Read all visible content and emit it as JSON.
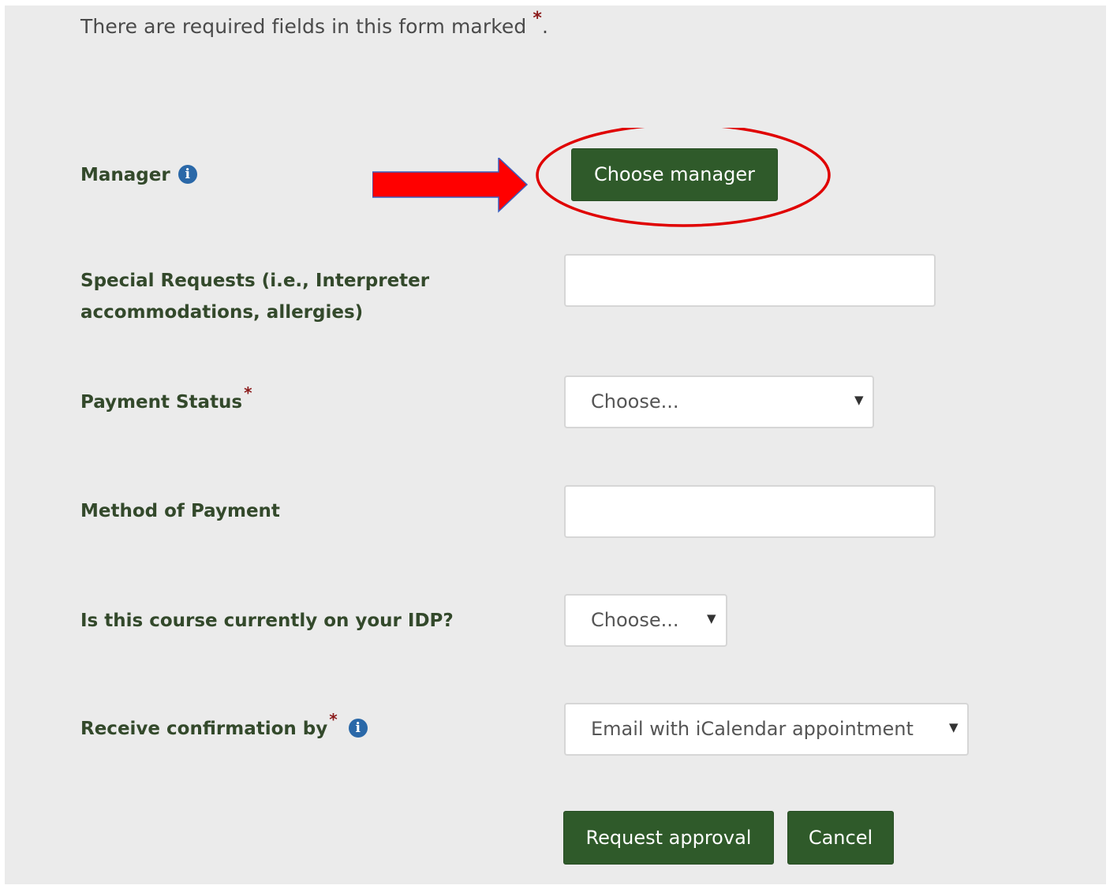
{
  "form": {
    "required_notice": "There are required fields in this form marked",
    "required_marker": "*",
    "notice_end": ".",
    "info_icon_glyph": "i"
  },
  "fields": {
    "manager": {
      "label": "Manager",
      "button_label": "Choose manager",
      "icon": "info-icon"
    },
    "special_requests": {
      "label_line1": "Special Requests (i.e., Interpreter",
      "label_line2": "accommodations, allergies)",
      "value": ""
    },
    "payment_status": {
      "label": "Payment Status",
      "required": "*",
      "selected": "Choose..."
    },
    "method_of_payment": {
      "label": "Method of Payment",
      "value": ""
    },
    "idp": {
      "label": "Is this course currently on your IDP?",
      "selected": "Choose..."
    },
    "confirmation": {
      "label": "Receive confirmation by",
      "required": "*",
      "selected": "Email with iCalendar appointment",
      "icon": "info-icon"
    }
  },
  "actions": {
    "request_approval": "Request approval",
    "cancel": "Cancel"
  },
  "annotation": {
    "arrow_color": "#ff0000",
    "circle_color": "#e00000"
  },
  "colors": {
    "button_green": "#2f5a2a",
    "label_green": "#33492b",
    "required_red": "#8b1a1a",
    "info_blue": "#2a68a8",
    "panel_bg": "#ebebeb"
  }
}
